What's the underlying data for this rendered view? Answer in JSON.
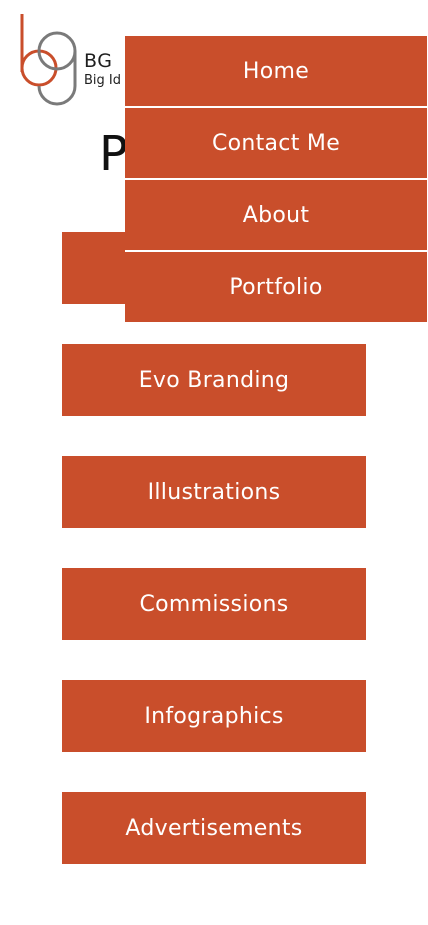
{
  "brand": {
    "title": "BG",
    "subtitle": "Big Id",
    "icon": "bg-monogram-logo",
    "accent": "#c94e2b",
    "gray": "#7a7a7a"
  },
  "page": {
    "title": "P"
  },
  "portfolio": {
    "items": [
      {
        "label": ""
      },
      {
        "label": "Evo Branding"
      },
      {
        "label": "Illustrations"
      },
      {
        "label": "Commissions"
      },
      {
        "label": "Infographics"
      },
      {
        "label": "Advertisements"
      }
    ]
  },
  "nav": {
    "items": [
      {
        "label": "Home"
      },
      {
        "label": "Contact Me"
      },
      {
        "label": "About"
      },
      {
        "label": "Portfolio"
      }
    ]
  },
  "colors": {
    "button_bg": "#c94e2b",
    "button_text": "#ffffff",
    "background": "#ffffff"
  }
}
